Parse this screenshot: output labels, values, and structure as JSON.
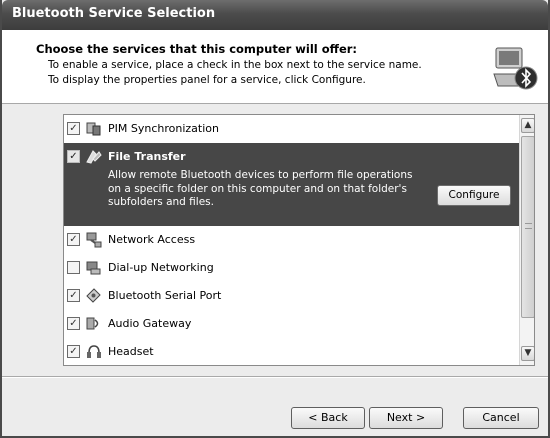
{
  "window": {
    "title": "Bluetooth Service Selection"
  },
  "header": {
    "title": "Choose the services that this computer will offer:",
    "line1": "To enable a service, place a check in the box next to the service name.",
    "line2": "To display the properties panel for a service, click Configure.",
    "icon": "bluetooth-computer-icon"
  },
  "services": [
    {
      "label": "PIM Synchronization",
      "checked": true,
      "icon": "pim-sync-icon"
    },
    {
      "label": "File Transfer",
      "checked": true,
      "icon": "file-transfer-icon",
      "selected": true,
      "description": "Allow remote Bluetooth devices to perform file operations on a specific folder on this computer and on that folder's subfolders and files.",
      "configure_label": "Configure"
    },
    {
      "label": "Network Access",
      "checked": true,
      "icon": "network-access-icon"
    },
    {
      "label": "Dial-up Networking",
      "checked": false,
      "icon": "dialup-networking-icon"
    },
    {
      "label": "Bluetooth Serial Port",
      "checked": true,
      "icon": "serial-port-icon"
    },
    {
      "label": "Audio Gateway",
      "checked": true,
      "icon": "audio-gateway-icon"
    },
    {
      "label": "Headset",
      "checked": true,
      "icon": "headset-icon"
    }
  ],
  "buttons": {
    "back": "< Back",
    "next": "Next >",
    "cancel": "Cancel"
  },
  "colors": {
    "selection": "#474747",
    "titlebar": "#4c4c4c"
  }
}
